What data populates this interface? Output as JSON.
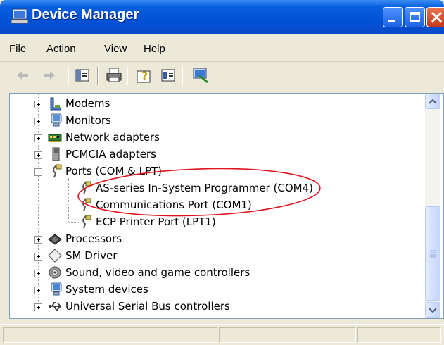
{
  "window": {
    "title": "Device Manager",
    "accent": "#0a5fe0"
  },
  "menu": {
    "items": [
      {
        "label": "File"
      },
      {
        "label": "Action"
      },
      {
        "label": "View"
      },
      {
        "label": "Help"
      }
    ]
  },
  "toolbar": {
    "icons": [
      "back-arrow-icon",
      "forward-arrow-icon",
      "properties-icon",
      "print-icon",
      "help-icon",
      "device-view-icon",
      "scan-hardware-icon"
    ]
  },
  "tree": {
    "rows": [
      {
        "label": "Modems",
        "icon": "modem-icon",
        "expander": "plus"
      },
      {
        "label": "Monitors",
        "icon": "monitor-icon",
        "expander": "plus"
      },
      {
        "label": "Network adapters",
        "icon": "network-adapter-icon",
        "expander": "plus"
      },
      {
        "label": "PCMCIA adapters",
        "icon": "pcmcia-icon",
        "expander": "plus"
      },
      {
        "label": "Ports (COM & LPT)",
        "icon": "port-icon",
        "expander": "minus"
      },
      {
        "label": "AS-series In-System Programmer (COM4)",
        "icon": "port-icon",
        "child": true,
        "highlighted": true
      },
      {
        "label": "Communications Port (COM1)",
        "icon": "port-icon",
        "child": true
      },
      {
        "label": "ECP Printer Port (LPT1)",
        "icon": "port-icon",
        "child": true
      },
      {
        "label": "Processors",
        "icon": "processor-icon",
        "expander": "plus"
      },
      {
        "label": "SM Driver",
        "icon": "sm-driver-icon",
        "expander": "plus"
      },
      {
        "label": "Sound, video and game controllers",
        "icon": "sound-icon",
        "expander": "plus"
      },
      {
        "label": "System devices",
        "icon": "system-device-icon",
        "expander": "plus"
      },
      {
        "label": "Universal Serial Bus controllers",
        "icon": "usb-icon",
        "expander": "plus"
      }
    ]
  },
  "annotation": {
    "color": "#e0141e"
  }
}
